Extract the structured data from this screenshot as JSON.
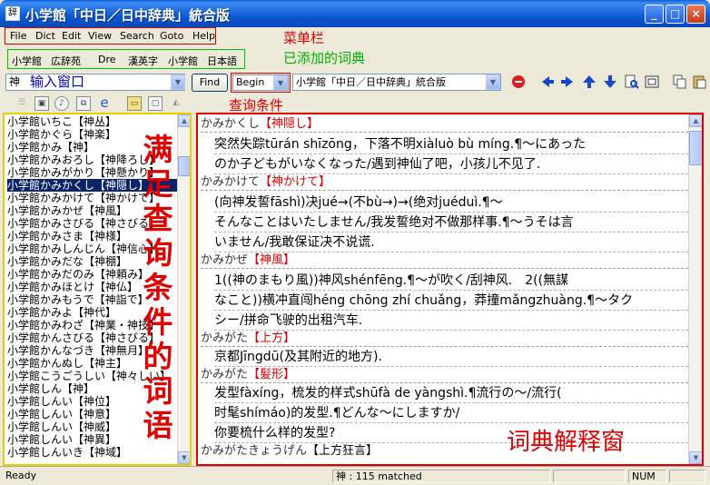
{
  "window": {
    "title": "小学館「中日／日中辞典」統合版",
    "controls": [
      "_",
      "□",
      "×"
    ]
  },
  "menu": {
    "items": [
      "File",
      "Dict",
      "Edit",
      "View",
      "Search",
      "Goto",
      "Help"
    ]
  },
  "dict_tabs": [
    "小学館",
    "広辞苑",
    "Dre",
    "漢英字",
    "小学館",
    "日本語"
  ],
  "annotations": {
    "menubar": "菜单栏",
    "dicts": "已添加的词典",
    "input_window": "输入窗口",
    "search_condition": "查询条件",
    "word_list": "满足查询条件的词语",
    "definition": "词典解释窗"
  },
  "toolbar": {
    "search_value": "神",
    "find_label": "Find",
    "condition_value": "Begin",
    "dict_select_value": "小学館「中日／日中辞典」統合版",
    "icon_names": [
      "stop-icon",
      "prev-arrow-icon",
      "next-arrow-icon",
      "up-arrow-icon",
      "down-arrow-icon",
      "search-doc-icon",
      "fullscreen-icon",
      "copy-icon",
      "paste-icon"
    ]
  },
  "word_list": [
    {
      "text": "小学館いちこ【神丛】"
    },
    {
      "text": "小学館かぐら【神楽】"
    },
    {
      "text": "小学館かみ【神】"
    },
    {
      "text": "小学館かみおろし【神降ろし】"
    },
    {
      "text": "小学館かみがかり【神懸かり】"
    },
    {
      "text": "小学館かみかくし【神隠し】",
      "selected": true
    },
    {
      "text": "小学館かみかけて【神かけて】"
    },
    {
      "text": "小学館かみかぜ【神風】"
    },
    {
      "text": "小学館かみさびる【神さびる】"
    },
    {
      "text": "小学館かみさま【神様】"
    },
    {
      "text": "小学館かみしんじん【神信心】"
    },
    {
      "text": "小学館かみだな【神棚】"
    },
    {
      "text": "小学館かみだのみ【神頼み】"
    },
    {
      "text": "小学館かみほとけ【神仏】"
    },
    {
      "text": "小学館かみもうで【神詣で】"
    },
    {
      "text": "小学館かみよ【神代】"
    },
    {
      "text": "小学館かみわざ【神業・神技】"
    },
    {
      "text": "小学館かんさびる【神さびる】"
    },
    {
      "text": "小学館かんなづき【神無月】"
    },
    {
      "text": "小学館かんぬし【神主】"
    },
    {
      "text": "小学館こうごうしい【神々しい】"
    },
    {
      "text": "小学館しん【神】"
    },
    {
      "text": "小学館しんい【神位】"
    },
    {
      "text": "小学館しんい【神意】"
    },
    {
      "text": "小学館しんい【神威】"
    },
    {
      "text": "小学館しんい【神異】"
    },
    {
      "text": "小学館しんいき【神域】"
    }
  ],
  "entries": [
    {
      "headword_kana": "かみかくし",
      "headword_kanji": "【神隠し】",
      "lines": [
        "突然失踪tūrán shīzōng，下落不明xiàluò bù míng.¶～にあったのか子どもがいなくなった/遇到神仙了吧，小孩儿不见了."
      ]
    },
    {
      "headword_kana": "かみかけて",
      "headword_kanji": "【神かけて】",
      "lines": [
        "(向神发誓fāshì)决jué→(不bù→)→(绝对juéduì.¶～そんなことはいたしません/我发誓绝对不做那样事.¶～うそは言いません/我敢保证决不说谎."
      ]
    },
    {
      "headword_kana": "かみかぜ",
      "headword_kanji": "【神風】",
      "lines": [
        "1((神のまもり風))神风shénfēng.¶～が吹く/刮神风.　2((無謀なこと))横冲直闯héng chōng zhí chuǎng,莽撞mǎngzhuàng.¶～タクシー/拼命飞驶的出租汽车."
      ]
    },
    {
      "headword_kana": "かみがた",
      "headword_kanji": "【上方】",
      "lines": [
        "京都Jīngdū(及其附近的地方)."
      ]
    },
    {
      "headword_kana": "かみがた",
      "headword_kanji": "【髪形】",
      "lines": [
        "发型fàxíng,梳发的样式shūfà de yàngshì.¶流行の～/流行(时髦shímáo)的发型.¶どんな～にしますか/你要梳什么样的发型?"
      ]
    },
    {
      "headword_kana": "かみがたきょうげん",
      "headword_kanji": "【上方狂言】",
      "lines": []
    }
  ],
  "def_lines": [
    "突然失踪tūrán shīzōng，下落不明xiàluò bù míng.¶～にあった",
    "のか子どもがいなくなった/遇到神仙了吧，小孩儿不见了.",
    "(向神发誓fāshì)决jué→(不bù→)→(绝对juéduì.¶～",
    "そんなことはいたしません/我发誓绝对不做那样事.¶～うそは言",
    "いません/我敢保证决不说谎.",
    "1((神のまもり風))神风shénfēng.¶～が吹く/刮神风.　2((無謀",
    "なこと))横冲直闯héng chōng zhí chuǎng，莽撞mǎngzhuàng.¶～タク",
    "シー/拼命飞驶的出租汽车.",
    "京都Jīngdū(及其附近的地方).",
    "发型fàxíng，梳发的样式shūfà de yàngshì.¶流行の～/流行(",
    "时髦shímáo)的发型.¶どんな～にしますか/",
    "你要梳什么样的发型?"
  ],
  "status": {
    "ready": "Ready",
    "match": "神 : 115 matched",
    "num": "NUM"
  }
}
